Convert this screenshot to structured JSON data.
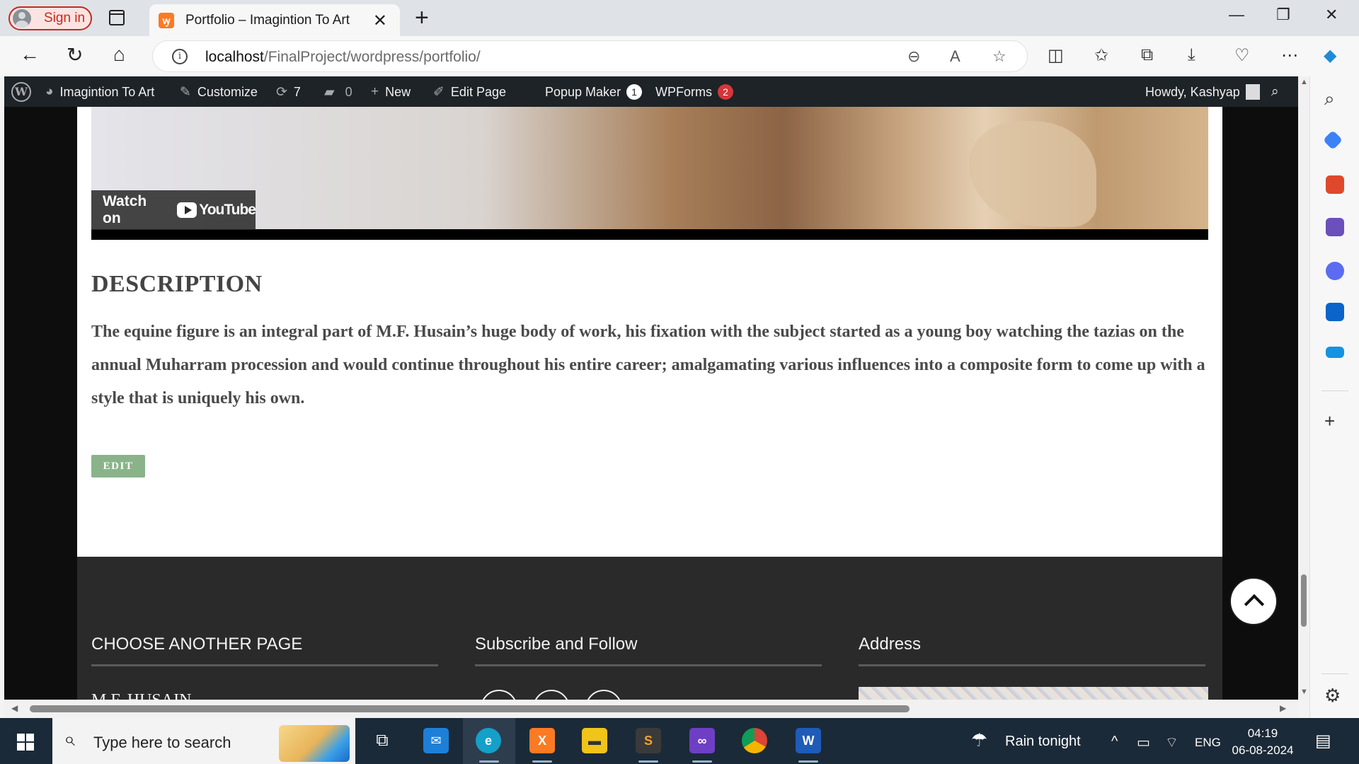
{
  "browser": {
    "sign_in": "Sign in",
    "tab_title": "Portfolio – Imagintion To Art",
    "url_host": "localhost",
    "url_path": "/FinalProject/wordpress/portfolio/"
  },
  "adminbar": {
    "site_name": "Imagintion To Art",
    "customize": "Customize",
    "updates_count": "7",
    "comments_count": "0",
    "new": "New",
    "edit_page": "Edit Page",
    "popup_maker": "Popup Maker",
    "popup_maker_badge": "1",
    "wpforms": "WPForms",
    "wpforms_badge": "2",
    "howdy": "Howdy, Kashyap"
  },
  "video": {
    "watch_on": "Watch on",
    "brand": "YouTube"
  },
  "content": {
    "heading": "DESCRIPTION",
    "paragraph": "The equine figure is an integral part of M.F. Husain’s huge body of work, his fixation with the subject started as a young boy watching the tazias on the annual Muharram procession and would continue throughout his entire career; amalgamating various influences into a composite form to come up with a style that is uniquely his own.",
    "edit_button": "EDIT"
  },
  "footer": {
    "col1_heading": "CHOOSE ANOTHER PAGE",
    "col1_first_link": "M.F. HUSAIN",
    "col2_heading": "Subscribe and Follow",
    "col3_heading": "Address"
  },
  "taskbar": {
    "search_placeholder": "Type here to search",
    "weather": "Rain tonight",
    "language": "ENG",
    "time": "04:19",
    "date": "06-08-2024"
  },
  "colors": {
    "admin_bar": "#1d2327",
    "edit_button": "#8ab38a",
    "footer_bg": "#2a2a2a",
    "taskbar": "#1b2a38",
    "badge_red": "#d63638"
  }
}
